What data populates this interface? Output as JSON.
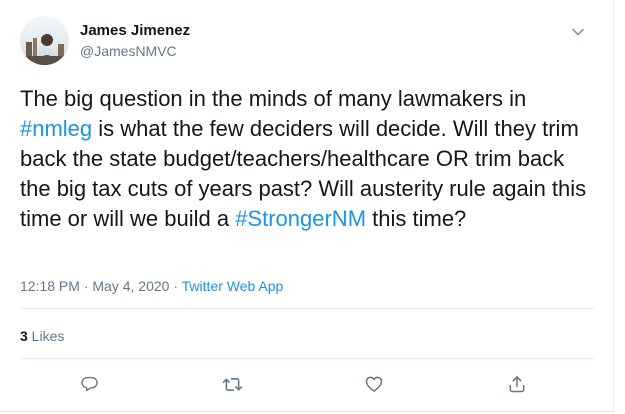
{
  "author": {
    "display_name": "James Jimenez",
    "handle": "@JamesNMVC"
  },
  "tweet": {
    "segments": [
      {
        "text": "The big question in the minds of many lawmakers in ",
        "type": "text"
      },
      {
        "text": "#nmleg",
        "type": "hashtag"
      },
      {
        "text": " is what the few deciders will decide. Will they trim back the state budget/teachers/healthcare OR trim back the big tax cuts of years past? Will austerity rule again this time or will we build a ",
        "type": "text"
      },
      {
        "text": "#StrongerNM",
        "type": "hashtag"
      },
      {
        "text": " this time?",
        "type": "text"
      }
    ]
  },
  "meta": {
    "time": "12:18 PM",
    "separator": " · ",
    "date": "May 4, 2020",
    "source": "Twitter Web App"
  },
  "stats": {
    "likes_count": "3",
    "likes_label": " Likes"
  },
  "icons": {
    "menu": "chevron-down-icon",
    "reply": "reply-icon",
    "retweet": "retweet-icon",
    "like": "heart-icon",
    "share": "share-icon"
  },
  "colors": {
    "link": "#1b95e0",
    "text": "#14171a",
    "secondary": "#657786",
    "border": "#e6ecf0"
  }
}
